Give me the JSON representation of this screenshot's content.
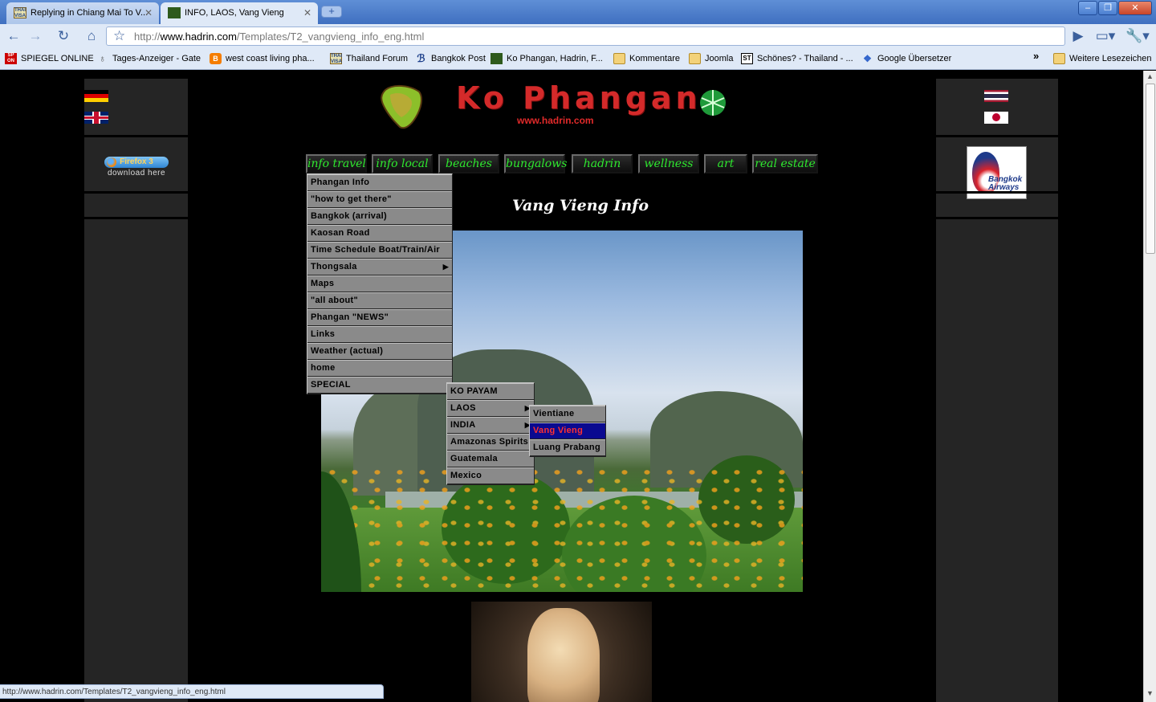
{
  "browser": {
    "tabs": [
      {
        "title": "Replying in Chiang Mai To V...",
        "favicon": "thaivisa-icon",
        "active": false
      },
      {
        "title": "INFO, LAOS, Vang Vieng",
        "favicon": "hadrin-icon",
        "active": true
      }
    ],
    "url_prefix": "http://",
    "url_domain": "www.hadrin.com",
    "url_path": "/Templates/T2_vangvieng_info_eng.html",
    "bookmarks": [
      {
        "label": "SPIEGEL ONLINE",
        "icon": "spiegel-icon"
      },
      {
        "label": "Tages-Anzeiger - Gate",
        "icon": "tagi-icon"
      },
      {
        "label": "west coast living pha...",
        "icon": "blogger-icon"
      },
      {
        "label": "Thailand Forum",
        "icon": "thaivisa-icon"
      },
      {
        "label": "Bangkok Post",
        "icon": "bangkokpost-icon"
      },
      {
        "label": "Ko Phangan, Hadrin, F...",
        "icon": "hadrin-icon"
      },
      {
        "label": "Kommentare",
        "icon": "folder-icon"
      },
      {
        "label": "Joomla",
        "icon": "folder-icon"
      },
      {
        "label": "Schönes? - Thailand - ...",
        "icon": "st-icon"
      },
      {
        "label": "Google Übersetzer",
        "icon": "google-icon"
      }
    ],
    "other_bookmarks": "Weitere Lesezeichen",
    "status_text": "http://www.hadrin.com/Templates/T2_vangvieng_info_eng.html"
  },
  "site": {
    "title": "Ko  Phangan",
    "url": "www.hadrin.com",
    "firefox_badge": "Firefox 3",
    "firefox_sub": "download here",
    "ad_text": "Bangkok Airways",
    "nav": [
      "info travel",
      "info local",
      "beaches",
      "bungalows",
      "hadrin",
      "wellness",
      "art",
      "real estate"
    ],
    "heading": "Vang Vieng  Info",
    "menu_main": [
      {
        "label": "Phangan Info"
      },
      {
        "label": "\"how to get there\""
      },
      {
        "label": "Bangkok (arrival)"
      },
      {
        "label": "Kaosan Road"
      },
      {
        "label": "Time Schedule Boat/Train/Air"
      },
      {
        "label": "Thongsala",
        "submenu": true
      },
      {
        "label": "Maps"
      },
      {
        "label": "\"all about\""
      },
      {
        "label": "Phangan \"NEWS\""
      },
      {
        "label": "Links"
      },
      {
        "label": "Weather (actual)"
      },
      {
        "label": "home"
      },
      {
        "label": "SPECIAL",
        "submenu": true
      }
    ],
    "menu_special": [
      {
        "label": "KO PAYAM"
      },
      {
        "label": "LAOS",
        "submenu": true
      },
      {
        "label": "INDIA",
        "submenu": true
      },
      {
        "label": "Amazonas Spirits"
      },
      {
        "label": "Guatemala"
      },
      {
        "label": "Mexico"
      }
    ],
    "menu_laos": [
      {
        "label": "Vientiane"
      },
      {
        "label": "Vang Vieng",
        "selected": true
      },
      {
        "label": "Luang Prabang"
      }
    ]
  },
  "colors": {
    "nav_text": "#2ee82e",
    "title_red": "#d42a2a",
    "menu_bg": "#8a8a8a",
    "menu_selected_bg": "#0a0a90",
    "menu_selected_text": "#ff3030"
  }
}
